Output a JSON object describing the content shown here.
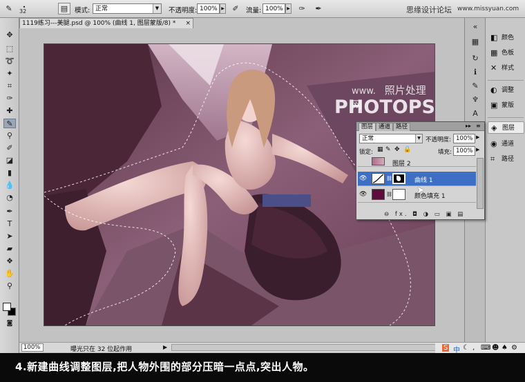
{
  "top_toolbar": {
    "brush_size": "32",
    "mode_label": "模式:",
    "mode_value": "正常",
    "opacity_label": "不透明度:",
    "opacity_value": "100%",
    "flow_label": "流量:",
    "flow_value": "100%",
    "watermark_forum": "思缘设计论坛",
    "watermark_site": "www.missyuan.com"
  },
  "document": {
    "tab_title": "1119练习---美腿.psd @ 100% (曲线 1, 图层蒙版/8) *",
    "close_glyph": "×"
  },
  "canvas_watermark": {
    "line1": "www.",
    "line1_cn": "照片处理网",
    "line2": "PHOTOPS.COM"
  },
  "status_bar": {
    "zoom": "100%",
    "info": "曝光只在 32 位起作用",
    "arrow": "▶"
  },
  "right_panels": [
    {
      "label": "颜色",
      "icon": "palette-icon",
      "glyph": "◧"
    },
    {
      "label": "色板",
      "icon": "swatches-icon",
      "glyph": "▦"
    },
    {
      "label": "样式",
      "icon": "styles-icon",
      "glyph": "✕"
    },
    {
      "label": "调整",
      "icon": "adjustments-icon",
      "glyph": "◐"
    },
    {
      "label": "蒙版",
      "icon": "masks-icon",
      "glyph": "▣"
    },
    {
      "label": "图层",
      "icon": "layers-icon",
      "glyph": "◈",
      "active": true
    },
    {
      "label": "通道",
      "icon": "channels-icon",
      "glyph": "◉"
    },
    {
      "label": "路径",
      "icon": "paths-icon",
      "glyph": "⌗"
    }
  ],
  "layers_panel": {
    "tabs": [
      "图层",
      "通道",
      "路径"
    ],
    "blend_mode": "正常",
    "opacity_label": "不透明度:",
    "opacity_value": "100%",
    "lock_label": "锁定:",
    "fill_label": "填充:",
    "fill_value": "100%",
    "layers": [
      {
        "name": "图层 2",
        "visible": false,
        "active": false
      },
      {
        "name": "曲线 1",
        "visible": true,
        "active": true
      },
      {
        "name": "颜色填充 1",
        "visible": true,
        "active": false
      }
    ],
    "footer_icons": "⊖ fx. ◘ ◑ ▭ ▣ ▤"
  },
  "caption": "4.新建曲线调整图层,把人物外围的部分压暗一点点,突出人物。",
  "tray": {
    "s": "S",
    "zh": "中"
  },
  "colors": {
    "canvas_tint": "#7d4a63",
    "selection": "#3d6fc4",
    "caption_bg": "#0a0a0a"
  }
}
